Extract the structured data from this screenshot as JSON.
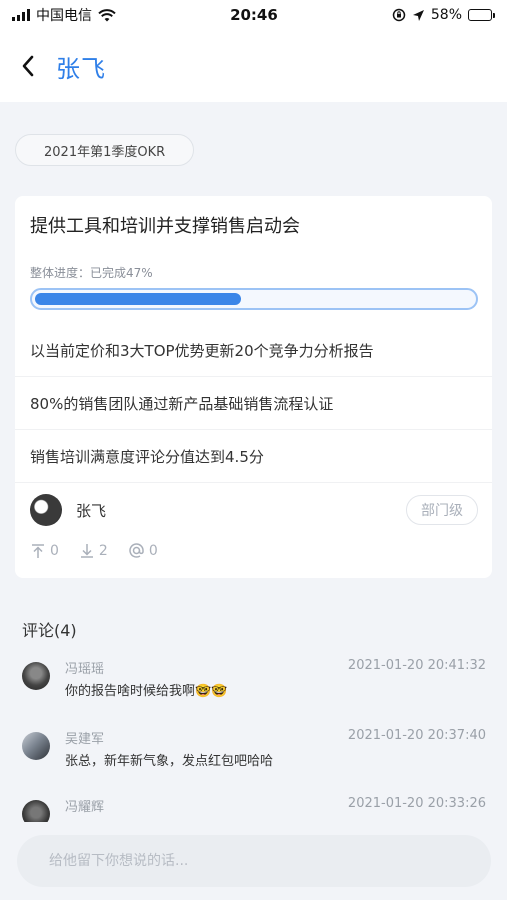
{
  "status_bar": {
    "carrier": "中国电信",
    "time": "20:46",
    "battery": "58%",
    "battery_level": 0.58,
    "icons": [
      "signal-icon",
      "wifi-icon",
      "rotation-lock-icon",
      "location-arrow-icon",
      "battery-icon"
    ]
  },
  "nav": {
    "title": "张飞",
    "back_icon": "chevron-left-icon"
  },
  "okr_period": "2021年第1季度OKR",
  "objective": {
    "title": "提供工具和培训并支撑销售启动会",
    "progress_label": "整体进度：已完成47%",
    "progress_percent": 47,
    "key_results": [
      "以当前定价和3大TOP优势更新20个竞争力分析报告",
      "80%的销售团队通过新产品基础销售流程认证",
      "销售培训满意度评论分值达到4.5分"
    ],
    "owner": "张飞",
    "level": "部门级",
    "stats": {
      "up": "0",
      "down": "2",
      "mention": "0"
    }
  },
  "comments_title": "评论(4)",
  "comments": [
    {
      "name": "冯瑶瑶",
      "time": "2021-01-20 20:41:32",
      "text": "你的报告啥时候给我啊🤓🤓"
    },
    {
      "name": "吴建军",
      "time": "2021-01-20 20:37:40",
      "text": "张总，新年新气象，发点红包吧哈哈"
    },
    {
      "name": "冯耀辉",
      "time": "2021-01-20 20:33:26",
      "text": ""
    }
  ],
  "input": {
    "placeholder": "给他留下你想说的话..."
  },
  "colors": {
    "accent": "#2f7fe8",
    "progress_fill": "#3b86e8",
    "background": "#f2f4f8"
  }
}
